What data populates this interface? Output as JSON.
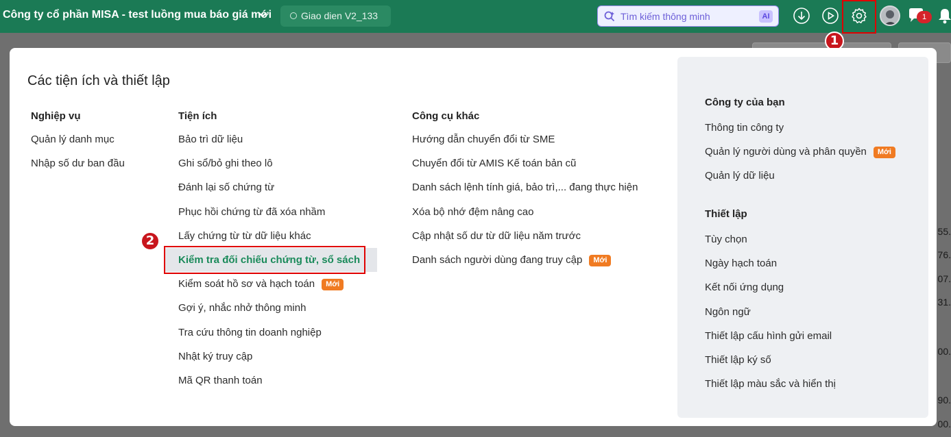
{
  "topbar": {
    "company_name": "Công ty cổ phần MISA - test luồng mua báo giá mới",
    "version_label": "Giao dien V2_133",
    "search_placeholder": "Tìm kiếm thông minh",
    "ai_label": "AI",
    "notification_count": "1",
    "icons": [
      "chevron-down-icon",
      "download-icon",
      "play-icon",
      "gear-icon",
      "avatar",
      "chat-icon",
      "bell-icon"
    ]
  },
  "callouts": {
    "step1": "1",
    "step2": "2"
  },
  "background": {
    "numbers": [
      "55.",
      "76.",
      "07.",
      "31.",
      "00.",
      "90.",
      "00."
    ]
  },
  "modal": {
    "title": "Các tiện ích và thiết lập",
    "columns": [
      {
        "heading": "Nghiệp vụ",
        "items": [
          "Quản lý danh mục",
          "Nhập số dư ban đầu"
        ]
      },
      {
        "heading": "Tiện ích",
        "items": [
          "Bảo trì dữ liệu",
          "Ghi sổ/bỏ ghi theo lô",
          "Đánh lại số chứng từ",
          "Phục hồi chứng từ đã xóa nhầm",
          "Lấy chứng từ từ dữ liệu khác",
          "Kiểm tra đối chiếu chứng từ, sổ sách",
          "Kiểm soát hồ sơ và hạch toán",
          "Gợi ý, nhắc nhở thông minh",
          "Tra cứu thông tin doanh nghiệp",
          "Nhật ký truy cập",
          "Mã QR thanh toán"
        ],
        "new_badge": "Mới"
      },
      {
        "heading": "Công cụ khác",
        "items": [
          "Hướng dẫn chuyển đổi từ SME",
          "Chuyển đổi từ AMIS Kế toán bản cũ",
          "Danh sách lệnh tính giá, bảo trì,... đang thực hiện",
          "Xóa bộ nhớ đệm nâng cao",
          "Cập nhật số dư từ dữ liệu năm trước",
          "Danh sách người dùng đang truy cập"
        ],
        "new_badge": "Mới"
      }
    ],
    "right_panel": {
      "company_heading": "Công ty của bạn",
      "company_items": [
        "Thông tin công ty",
        "Quản lý người dùng và phân quyền",
        "Quản lý dữ liệu"
      ],
      "new_badge": "Mới",
      "settings_heading": "Thiết lập",
      "settings_items": [
        "Tùy chọn",
        "Ngày hạch toán",
        "Kết nối ứng dụng",
        "Ngôn ngữ",
        "Thiết lập cấu hình gửi email",
        "Thiết lập ký số",
        "Thiết lập màu sắc và hiển thị"
      ]
    }
  },
  "colors": {
    "topbar": "#1b7a55",
    "highlight_text": "#1a8a5a",
    "annotation_red": "#e00000",
    "badge_orange": "#f07b22"
  }
}
